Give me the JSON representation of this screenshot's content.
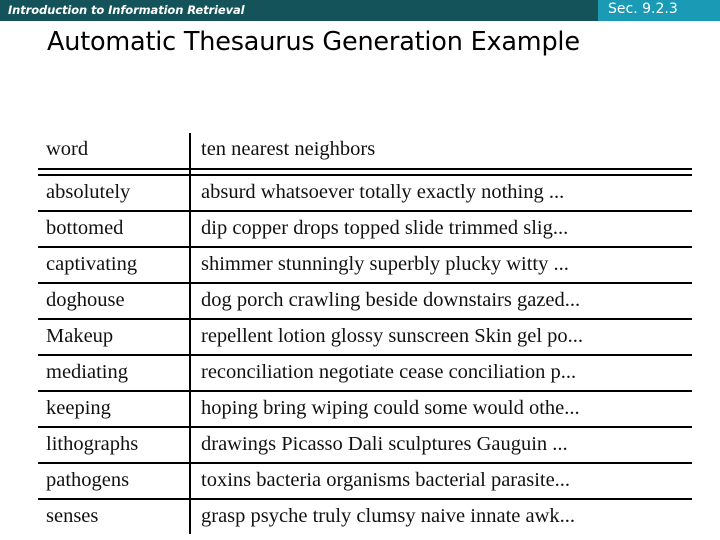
{
  "header": {
    "course_title": "Introduction to Information Retrieval",
    "section_label": "Sec. 9.2.3",
    "bar_color": "#14535a",
    "badge_color": "#1a9ab5",
    "text_color": "#ffffff"
  },
  "slide": {
    "title": "Automatic Thesaurus Generation Example"
  },
  "table": {
    "columns": [
      "word",
      "ten nearest neighbors"
    ],
    "rows": [
      {
        "word": "absolutely",
        "neighbors": "absurd whatsoever totally exactly nothing ..."
      },
      {
        "word": "bottomed",
        "neighbors": "dip copper drops topped slide trimmed slig..."
      },
      {
        "word": "captivating",
        "neighbors": "shimmer stunningly superbly plucky witty ..."
      },
      {
        "word": "doghouse",
        "neighbors": "dog porch crawling beside downstairs gazed..."
      },
      {
        "word": "Makeup",
        "neighbors": "repellent lotion glossy sunscreen Skin gel po..."
      },
      {
        "word": "mediating",
        "neighbors": "reconciliation negotiate cease conciliation p..."
      },
      {
        "word": "keeping",
        "neighbors": "hoping bring wiping could some would othe..."
      },
      {
        "word": "lithographs",
        "neighbors": "drawings Picasso Dali sculptures Gauguin ..."
      },
      {
        "word": "pathogens",
        "neighbors": "toxins bacteria organisms bacterial parasite..."
      },
      {
        "word": "senses",
        "neighbors": "grasp psyche truly clumsy naive innate awk..."
      }
    ]
  }
}
